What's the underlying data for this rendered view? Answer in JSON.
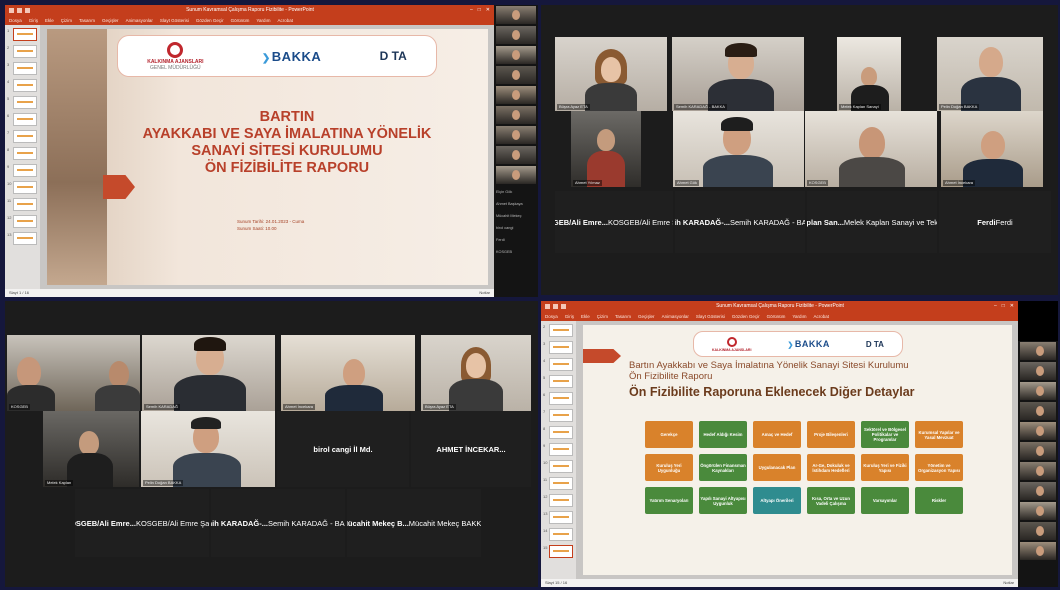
{
  "screen1": {
    "window_title": "Sunum Kavramsal Çalışma Raporu Fizibilite - PowerPoint",
    "menu": [
      "Dosya",
      "Giriş",
      "Ekle",
      "Çizim",
      "Tasarım",
      "Geçişler",
      "Animasyonlar",
      "Slayt Gösterisi",
      "Gözden Geçir",
      "Görünüm",
      "Yardım",
      "Acrobat"
    ],
    "status_left": "Slayt 1 / 16",
    "status_right": "Notlar",
    "slide_numbers": [
      "1",
      "2",
      "3",
      "4",
      "5",
      "6",
      "7",
      "8",
      "9",
      "10",
      "11",
      "12",
      "13"
    ],
    "logos": {
      "ka_name": "KALKINMA AJANSLARI",
      "ka_sub": "GENEL MÜDÜRLÜĞÜ",
      "bakka": "BAKKA",
      "dota": "D TA"
    },
    "heading": [
      "BARTIN",
      "AYAKKABI VE SAYA İMALATINA YÖNELİK",
      "SANAYİ SİTESİ KURULUMU",
      "ÖN FİZİBİLİTE RAPORU"
    ],
    "date_line1": "Sunum Tarihi: 24.01.2023 - Cuma",
    "date_line2": "Sunum Saati: 10.00",
    "strip_names": [
      "Elçin Gök",
      "Ahmet Başkaya",
      "Mücahit Mekeç",
      "birol cangi",
      "Ferdi",
      "KOSGEB"
    ]
  },
  "screen2": {
    "tiles": [
      {
        "label": "Büşra Ayaz ETA"
      },
      {
        "label": "Semih KARADAĞ - BAKKA"
      },
      {
        "label": "Melek Kaplan Sanayi"
      },
      {
        "label": "Pelin Doğan BAKKA"
      },
      {
        "label": "Ahmet Yılmaz"
      },
      {
        "label": "Ahmet Gök"
      },
      {
        "label": "KOSGEB"
      },
      {
        "label": "Ahmet İncekara"
      }
    ],
    "names": [
      "KOSGEB/Ali Emre...",
      "Semih KARADAĞ-...",
      "Melek Kaplan San...",
      "Ferdi"
    ],
    "sublabels": [
      "KOSGEB/Ali Emre Şahin",
      "Semih KARADAĞ - BAKKA",
      "Melek Kaplan Sanayi ve Teknoloji Md.",
      "Ferdi"
    ]
  },
  "screen3": {
    "tiles": [
      {
        "label": "KOSGEB"
      },
      {
        "label": "Semih KARADAĞ"
      },
      {
        "label": "Ahmet İncekara"
      },
      {
        "label": "Büşra Ayaz ETA"
      },
      {
        "label": "Melek Kaplan"
      },
      {
        "label": "Pelin Doğan BAKKA"
      }
    ],
    "names": [
      "birol cangi İl Md.",
      "AHMET İNCEKAR...",
      "KOSGEB/Ali Emre...",
      "Semih KARADAĞ-...",
      "Mücahit Mekeç B..."
    ],
    "sublabels": [
      "KOSGEB/Ali Emre Şahin",
      "Semih KARADAĞ - BAKKA",
      "Mücahit Mekeç BAKKA"
    ]
  },
  "screen4": {
    "window_title": "Sunum Kavramsal Çalışma Raporu Fizibilite - PowerPoint",
    "menu": [
      "Dosya",
      "Giriş",
      "Ekle",
      "Çizim",
      "Tasarım",
      "Geçişler",
      "Animasyonlar",
      "Slayt Gösterisi",
      "Gözden Geçir",
      "Görünüm",
      "Yardım",
      "Acrobat"
    ],
    "status_left": "Slayt 15 / 16",
    "status_right": "Notlar",
    "slide_numbers": [
      "2",
      "3",
      "4",
      "5",
      "6",
      "7",
      "8",
      "9",
      "10",
      "11",
      "12",
      "13",
      "14",
      "15"
    ],
    "title_line": "Bartın Ayakkabı ve Saya İmalatına Yönelik Sanayi Sitesi Kurulumu",
    "title_line2": "Ön Fizibilite Raporu",
    "subtitle": "Ön Fizibilite Raporuna Eklenecek Diğer Detaylar",
    "grid": [
      {
        "text": "Gerekçe",
        "color": "o"
      },
      {
        "text": "Hedef Aldığı Kesim",
        "color": "g"
      },
      {
        "text": "Amaç ve Hedef",
        "color": "o"
      },
      {
        "text": "Proje Bileşenleri",
        "color": "o"
      },
      {
        "text": "Sektörel ve Bölgesel Politikalar ve Programlar",
        "color": "g"
      },
      {
        "text": "Kurumsal Yapılar ve Yasal Mevzuat",
        "color": "o"
      },
      {
        "text": "Kuruluş Yeri Uygunluğu",
        "color": "o"
      },
      {
        "text": "Öngörülen Finansman Kaynakları",
        "color": "g"
      },
      {
        "text": "Uygulanacak Plan",
        "color": "o"
      },
      {
        "text": "Ar-Ge, Dokuluk ve İstihdam Hedefleri",
        "color": "o"
      },
      {
        "text": "Kuruluş Yeri ve Fiziki Yapısı",
        "color": "o"
      },
      {
        "text": "Yönetim ve Organizasyon Yapısı",
        "color": "o"
      },
      {
        "text": "Yatırım Senaryoları",
        "color": "g"
      },
      {
        "text": "Yapılı Sanayi Altyapısı Uygunluk",
        "color": "g"
      },
      {
        "text": "Altyapı Önerileri",
        "color": "t"
      },
      {
        "text": "Kısa, Orta ve Uzun Vadeli Çalışma",
        "color": "g"
      },
      {
        "text": "Varsayımlar",
        "color": "g"
      },
      {
        "text": "Riskler",
        "color": "g"
      }
    ]
  }
}
